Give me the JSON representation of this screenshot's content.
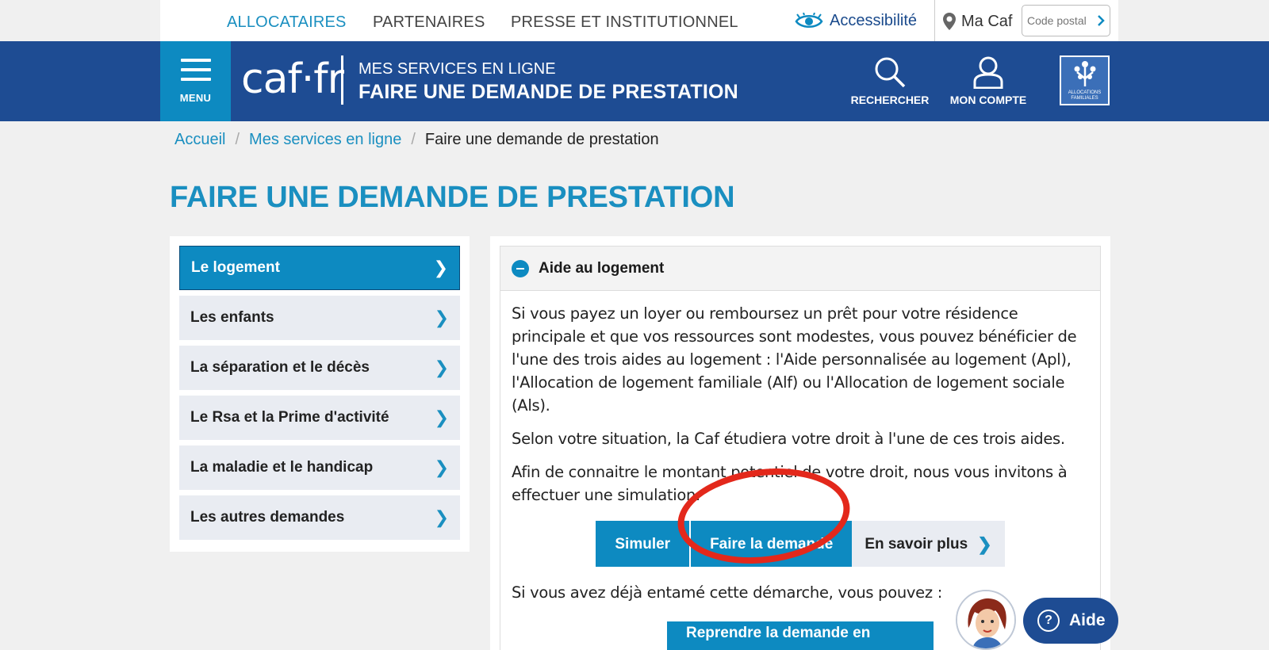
{
  "top_nav": {
    "items": [
      "ALLOCATAIRES",
      "PARTENAIRES",
      "PRESSE ET INSTITUTIONNEL"
    ],
    "accessibility_label": "Accessibilité",
    "ma_caf_label": "Ma Caf",
    "postal_placeholder": "Code postal"
  },
  "header": {
    "menu_label": "MENU",
    "logo_text": "caf·fr",
    "subtitle": "MES SERVICES EN LIGNE",
    "title": "FAIRE UNE DEMANDE DE PRESTATION",
    "search_label": "RECHERCHER",
    "account_label": "MON COMPTE",
    "seal_text": "ALLOCATIONS FAMILIALES"
  },
  "breadcrumb": {
    "home": "Accueil",
    "services": "Mes services en ligne",
    "current": "Faire une demande de prestation",
    "separator": "/"
  },
  "page_title": "FAIRE UNE DEMANDE DE PRESTATION",
  "sidebar": {
    "items": [
      {
        "label": "Le logement",
        "active": true
      },
      {
        "label": "Les enfants",
        "active": false
      },
      {
        "label": "La séparation et le décès",
        "active": false
      },
      {
        "label": "Le Rsa et la Prime d'activité",
        "active": false
      },
      {
        "label": "La maladie et le handicap",
        "active": false
      },
      {
        "label": "Les autres demandes",
        "active": false
      }
    ]
  },
  "accordion": {
    "title": "Aide au logement",
    "paragraphs": [
      "Si vous payez un loyer ou remboursez un prêt pour votre résidence principale et que vos ressources sont modestes, vous pouvez bénéficier de l'une des trois aides au logement : l'Aide personnalisée au logement (Apl), l'Allocation de logement familiale (Alf) ou l'Allocation de logement sociale (Als).",
      "Selon votre situation, la Caf étudiera votre droit à l'une de ces trois aides.",
      "Afin de connaitre le montant potentiel de votre droit, nous vous invitons à effectuer une simulation."
    ],
    "simulate_label": "Simuler",
    "apply_label": "Faire la demande",
    "learn_more_label": "En savoir plus",
    "already_started": "Si vous avez déjà entamé cette démarche, vous pouvez :",
    "resume_label": "Reprendre la demande en cours"
  },
  "help": {
    "label": "Aide",
    "icon_glyph": "?"
  },
  "colors": {
    "brand_blue": "#1e4c93",
    "accent_blue": "#0d8ac1",
    "highlight_red": "#e3281b"
  }
}
